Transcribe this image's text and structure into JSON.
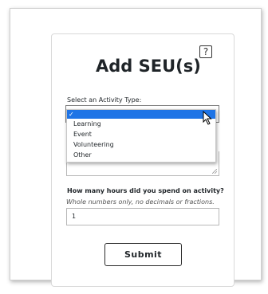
{
  "form": {
    "help_glyph": "?",
    "title": "Add SEU(s)",
    "activity_label": "Select an Activity Type:",
    "activity_options": [
      {
        "label": "✓",
        "selected": true
      },
      {
        "label": "Learning",
        "selected": false
      },
      {
        "label": "Event",
        "selected": false
      },
      {
        "label": "Volunteering",
        "selected": false
      },
      {
        "label": "Other",
        "selected": false
      }
    ],
    "hours_label": "How many hours did you spend on activity?",
    "hours_hint": "Whole numbers only, no decimals or fractions.",
    "hours_value": "1",
    "submit_label": "Submit"
  },
  "icons": {
    "help": "question-box-icon",
    "cursor": "mouse-pointer-icon",
    "resize": "resize-grip-icon"
  },
  "colors": {
    "selected_option_bg": "#1e74e6",
    "text": "#1f2428"
  }
}
